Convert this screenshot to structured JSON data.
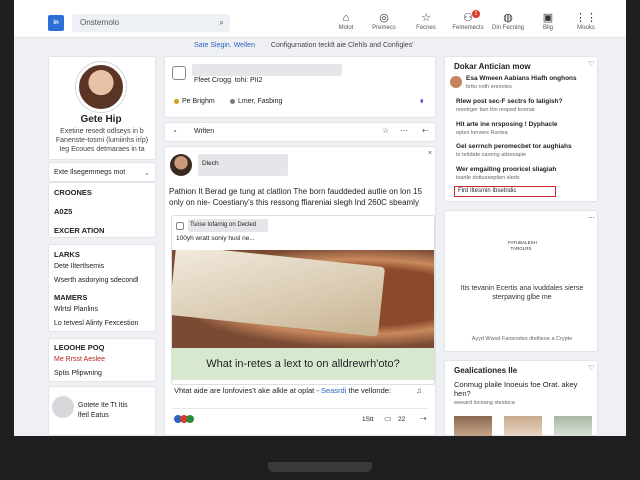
{
  "header": {
    "logo": "in",
    "search_text": "Onsternolo",
    "nav": [
      {
        "label": "Molot",
        "icon": "home-icon"
      },
      {
        "label": "Premecs",
        "icon": "network-icon"
      },
      {
        "label": "Fecnes",
        "icon": "star-icon"
      },
      {
        "label": "Fememects",
        "icon": "people-icon",
        "badge": "2"
      },
      {
        "label": "Din Fecning",
        "icon": "chat-icon"
      },
      {
        "label": "Blig",
        "icon": "bell-icon"
      },
      {
        "label": "Mooks",
        "icon": "grid-icon"
      }
    ]
  },
  "subnav": {
    "link": "Sate Slegin. Wellen",
    "text": "Configurnation tecklt aie Clehls and Configles'"
  },
  "profile": {
    "name": "Gete Hip",
    "description": "Exetine resedt odlseys in b Fanenste-tosmi (lumiinhs iríp) Ieg Ecoues detmaraes in ta",
    "menu_item": "Exte Ilsegemmegs mot",
    "sections": [
      "CROONES",
      "A0Z5",
      "EXCER ATION"
    ],
    "group_title": "LARKS",
    "group_items": [
      "Dete Iltertlsemis",
      "Wserth asdorying sdecondl"
    ],
    "group2_title": "MAMERS",
    "group2_items": [
      "Wlrtsl Planlins",
      "Lo tetvesl Alinty Fexcestion"
    ],
    "events_title": "LEOOHE POQ",
    "events_items": [
      "Me Rrsst Aeslee",
      "Sptis Pfipwning"
    ],
    "footer_line1": "Gotete Ite Tt Itis",
    "footer_line2": "lfetl Eatus"
  },
  "composer": {
    "line1": "Ffeet Crogg. tohi: PII2",
    "action1": "Pe Brighm",
    "action2": "Lmer, Fasbing"
  },
  "write_bar": {
    "label": "Wrlten"
  },
  "post": {
    "author": "Dlech",
    "body": "Pathion It Berad ge tung at clatlion The born fauddeded autlie on lon 15 only on nie- Coestiany's this ressong ffiareniai slegh lnd 260C sbeamly",
    "embed_header": "Tsose Iofarnig on Decled",
    "embed_sub": "100yh wratt soniy husl ne...",
    "caption": "What in-retes a lext to on alldrewrh'oto?",
    "footer_text": "Vhtat aide are lonfovies't ake alkle at oplat -",
    "footer_link": "Seasrdi",
    "footer_tail": "the vellonde:",
    "stat1": "1Stt",
    "stat2": "22"
  },
  "right_news": {
    "title": "Dokar Antician mow",
    "items": [
      {
        "head": "Esa Wmeen Aabians Hiafh onghons",
        "sub": "brtto noth enrectes"
      },
      {
        "head": "Rlew post sec-F sectrs fo Ialigish?",
        "sub": "resotrger tian thn reoped toomat"
      },
      {
        "head": "Hit arte ine nrsposing ! Dyphacle",
        "sub": "eptes lonvere Rsnlea"
      },
      {
        "head": "Gel serrnch peromecbet tor aughiahs",
        "sub": "to tetidate caoring atisesapie"
      },
      {
        "head": "Wer emgaiting prooricel sliagiah",
        "sub": "inartle dottusseptien sleds"
      }
    ],
    "highlight": "Flrd Iltesmin Ibsetndic"
  },
  "right_ad": {
    "brand": "FATUBALESH TARGLRS",
    "text": "Itis tevanin Ecertis ana ivuddales sierse sterpaving glbe me",
    "sub": "Ayyd Wwsd Fansnotes dtetlieoe a Crypte"
  },
  "right_people": {
    "title": "Gealicationes IIe",
    "text": "Conmug plaile Inoeuis foe Orat. akey hen?",
    "sub": "weeard loceang stestoca"
  }
}
